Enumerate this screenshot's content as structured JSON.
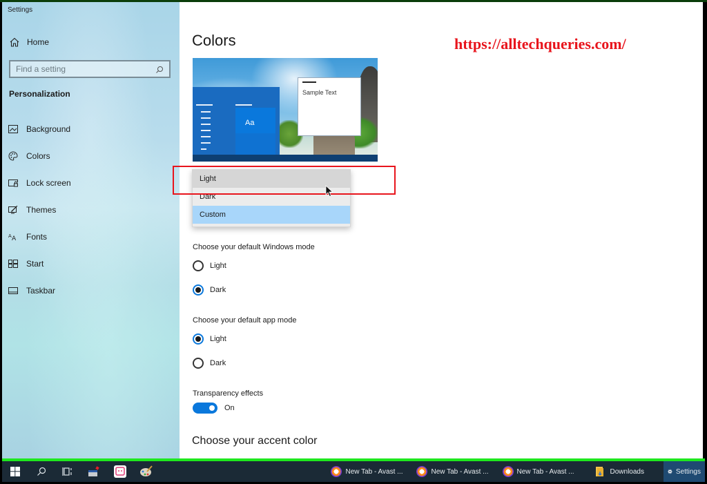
{
  "window": {
    "title": "Settings"
  },
  "sidebar": {
    "home_label": "Home",
    "search_placeholder": "Find a setting",
    "section_title": "Personalization",
    "items": [
      {
        "label": "Background",
        "icon": "image-icon"
      },
      {
        "label": "Colors",
        "icon": "palette-icon"
      },
      {
        "label": "Lock screen",
        "icon": "lock-screen-icon"
      },
      {
        "label": "Themes",
        "icon": "themes-icon"
      },
      {
        "label": "Fonts",
        "icon": "fonts-icon"
      },
      {
        "label": "Start",
        "icon": "start-icon"
      },
      {
        "label": "Taskbar",
        "icon": "taskbar-icon"
      }
    ]
  },
  "main": {
    "title": "Colors",
    "watermark": "https://alltechqueries.com/",
    "preview": {
      "tile_text": "Aa",
      "sample_text": "Sample Text"
    },
    "color_dropdown": {
      "options": [
        "Light",
        "Dark",
        "Custom"
      ],
      "hovered": "Light",
      "selected": "Custom"
    },
    "windows_mode": {
      "label": "Choose your default Windows mode",
      "options": [
        "Light",
        "Dark"
      ],
      "selected": "Dark"
    },
    "app_mode": {
      "label": "Choose your default app mode",
      "options": [
        "Light",
        "Dark"
      ],
      "selected": "Light"
    },
    "transparency": {
      "label": "Transparency effects",
      "state": "On",
      "enabled": true
    },
    "accent_title": "Choose your accent color"
  },
  "taskbar": {
    "pinned": [
      "start-icon",
      "search-icon",
      "task-view-icon",
      "app-icon",
      "chat-app-icon",
      "paint-icon"
    ],
    "tasks": [
      {
        "label": "New Tab - Avast ...",
        "icon": "avast-browser-icon",
        "active": false
      },
      {
        "label": "New Tab - Avast ...",
        "icon": "avast-browser-icon",
        "active": false
      },
      {
        "label": "New Tab - Avast ...",
        "icon": "avast-browser-icon",
        "active": false
      },
      {
        "label": "Downloads",
        "icon": "folder-icon",
        "active": false
      },
      {
        "label": "Settings",
        "icon": "gear-icon",
        "active": true
      }
    ]
  },
  "colors": {
    "accent": "#0a78dc",
    "highlight_box": "#e8141c",
    "watermark": "#e8141c",
    "dropdown_selected": "#a8d6fa",
    "taskbar": "#1b2a36"
  }
}
